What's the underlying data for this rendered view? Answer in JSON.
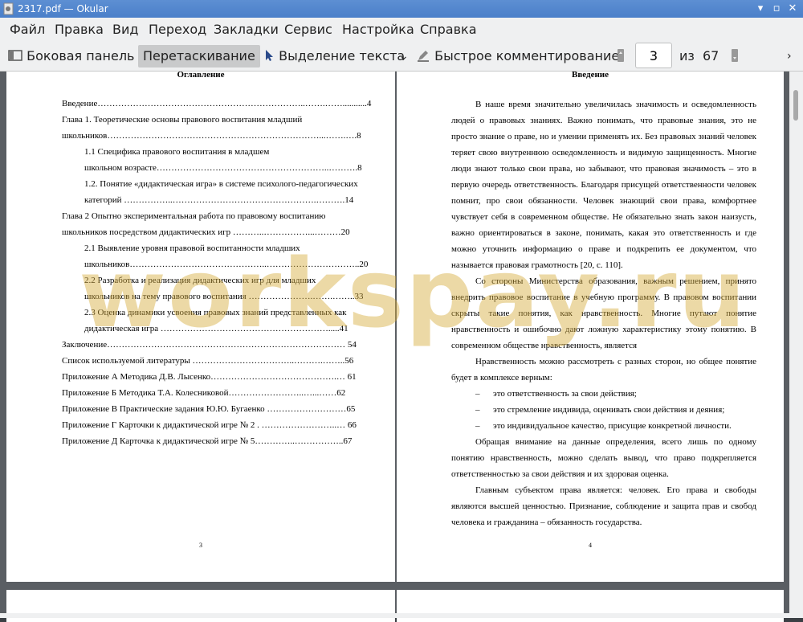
{
  "window": {
    "title": "2317.pdf — Okular"
  },
  "menu": [
    "Файл",
    "Правка",
    "Вид",
    "Переход",
    "Закладки",
    "Сервис",
    "Настройка",
    "Справка"
  ],
  "toolbar": {
    "sidebar": "Боковая панель",
    "drag": "Перетаскивание",
    "select_text": "Выделение текста",
    "quick_comment": "Быстрое комментирование",
    "page_value": "3",
    "of_label": "из",
    "total_pages": "67"
  },
  "left_page": {
    "heading": "Оглавление",
    "lines": [
      "Введение……………………………………………………………..…….……...........4",
      "Глава 1. Теоретические основы правового воспитания младший",
      "школьников………………………………………………………………...…….….8",
      "1.1    Специфика        правового воспитания        в        младшем",
      "школьном возрасте…………………………………………………..……….8",
      "1.2. Понятие «дидактическая игра» в системе психолого-педагогических",
      "категорий ……………..………………………………………….……….14",
      "Глава  2  Опытно  экспериментальная  работа  по  правовому  воспитанию",
      "школьников посредством дидактических игр ………..……………...………20",
      "2.1     Выявление уровня        правовой воспитанности     младших",
      "школьников………………………………………..…………………………..20",
      "2.2 Разработка и реализация дидактических игр для младших",
      "школьников на тему правового воспитания ………………….…….……..33",
      "2.3 Оценка динамики усвоения правовых знаний представленных как",
      "дидактическая    игра    ………………………………………………….....41",
      "Заключение……………………………………………………………………… 54",
      "Список используемой литературы ……………………………..……….……..56",
      "Приложение А Методика Д.В. Лысенко…………………………………….… 61",
      "Приложение Б Методика Т.А. Колесниковой……………………..…...……62",
      "Приложение В Практические задания Ю.Ю. Бугаенко ………………………65",
      "Приложение Г Карточки к дидактической игре № 2 . ……………………..… 66",
      "Приложение Д Карточка к дидактической игре № 5…………..……………..67"
    ],
    "page_number": "3"
  },
  "right_page": {
    "heading": "Введение",
    "paragraphs": [
      "В наше время значительно увеличилась значимость и осведомленность людей о правовых знаниях. Важно понимать, что правовые знания, это не просто знание о праве, но и умении применять их. Без правовых знаний человек теряет свою внутреннюю осведомленность и видимую защищенность. Многие люди знают только свои права, но забывают, что правовая значимость – это в первую очередь ответственность. Благодаря присущей ответственности человек помнит, про свои обязанности. Человек знающий свои права, комфортнее чувствует себя в современном обществе. Не обязательно знать закон наизусть, важно ориентироваться в законе, понимать, какая это ответственность и где можно уточнить информацию о праве и подкрепить ее документом, что называется правовая грамотность [20, с. 110].",
      "Со стороны Министерства образования, важным решением, принято внедрить правовое воспитание в учебную программу. В правовом воспитании скрыты такие понятия, как нравственность. Многие путают понятие нравственность и ошибочно дают ложную характеристику этому понятию.  В современном обществе нравственность, является",
      "Нравственность можно рассмотреть с разных сторон, но общее понятие будет в комплексе верным:"
    ],
    "bullets": [
      "это ответственность за свои действия;",
      "это стремление индивида, оценивать свои действия и деяния;",
      "это индивидуальное качество, присущие конкретной личности."
    ],
    "paragraphs2": [
      "Обращая внимание на данные определения, всего лишь по одному понятию нравственность, можно сделать вывод, что право подкрепляется ответственностью за свои действия и их здоровая оценка.",
      "Главным субъектом права является: человек. Его права и свободы являются высшей ценностью. Признание, соблюдение и защита прав и свобод человека и гражданина – обязанность государства."
    ],
    "page_number": "4"
  },
  "watermark": "workspay.ru"
}
